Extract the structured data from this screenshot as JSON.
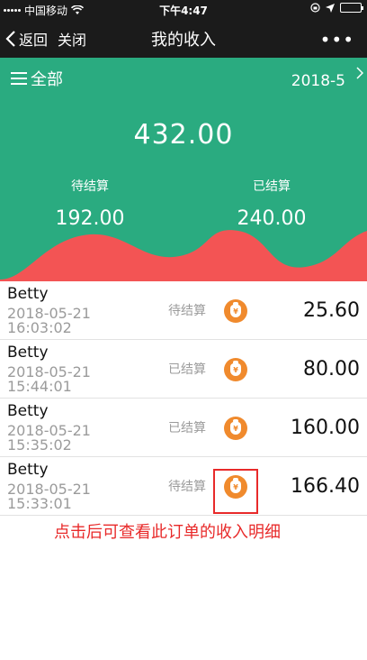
{
  "status_bar": {
    "carrier": "中国移动",
    "time": "下午4:47"
  },
  "nav": {
    "back_label": "返回",
    "close_label": "关闭",
    "title": "我的收入",
    "more_label": "•••"
  },
  "summary": {
    "filter_label": "全部",
    "month": "2018-5",
    "total": "432.00",
    "pending_label": "待结算",
    "pending_value": "192.00",
    "settled_label": "已结算",
    "settled_value": "240.00"
  },
  "colors": {
    "header_bg": "#2aab80",
    "wave": "#f35454",
    "icon": "#f08a2d",
    "annotation": "#e82a2a"
  },
  "rows": [
    {
      "name": "Betty",
      "date": "2018-05-21",
      "clock": "16:03:02",
      "status": "待结算",
      "amount": "25.60"
    },
    {
      "name": "Betty",
      "date": "2018-05-21",
      "clock": "15:44:01",
      "status": "已结算",
      "amount": "80.00"
    },
    {
      "name": "Betty",
      "date": "2018-05-21",
      "clock": "15:35:02",
      "status": "已结算",
      "amount": "160.00"
    },
    {
      "name": "Betty",
      "date": "2018-05-21",
      "clock": "15:33:01",
      "status": "待结算",
      "amount": "166.40"
    }
  ],
  "annotation": "点击后可查看此订单的收入明细",
  "icon_glyph": "¥"
}
